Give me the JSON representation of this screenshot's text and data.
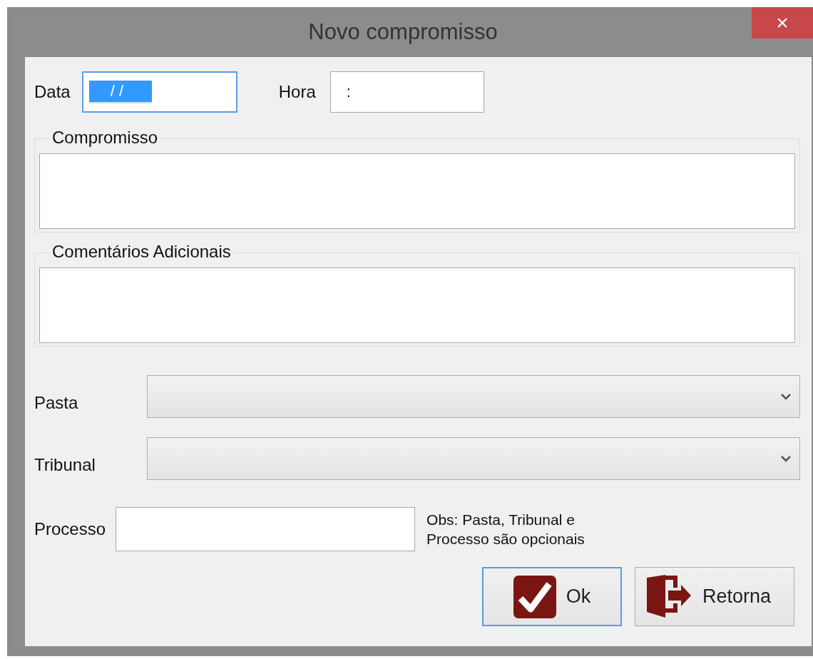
{
  "window": {
    "title": "Novo compromisso",
    "close": "×"
  },
  "date": {
    "label": "Data",
    "value": "/  /",
    "selected": true
  },
  "time": {
    "label": "Hora",
    "value": ":"
  },
  "groups": [
    {
      "label": "Compromisso"
    },
    {
      "label": "Comentários Adicionais"
    }
  ],
  "dropdowns": [
    {
      "label": "Pasta"
    },
    {
      "label": "Tribunal"
    }
  ],
  "process": {
    "label": "Processo"
  },
  "note": "Obs: Pasta, Tribunal e\nProcesso são opcionais",
  "buttons": [
    {
      "label": "Ok",
      "kind": "confirm",
      "focused": true
    },
    {
      "label": "Retorna",
      "kind": "exit",
      "focused": false
    }
  ]
}
